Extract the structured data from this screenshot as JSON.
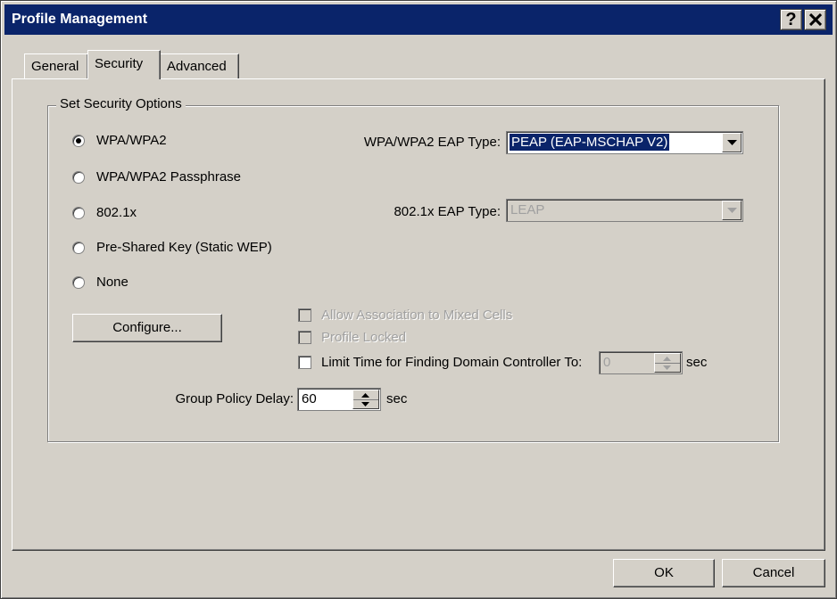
{
  "window": {
    "title": "Profile Management",
    "help_glyph": "?",
    "close_icon": "close-icon"
  },
  "tabs": [
    {
      "label": "General",
      "selected": false
    },
    {
      "label": "Security",
      "selected": true
    },
    {
      "label": "Advanced",
      "selected": false
    }
  ],
  "security": {
    "group_label": "Set Security Options",
    "options": [
      {
        "label": "WPA/WPA2",
        "selected": true
      },
      {
        "label": "WPA/WPA2 Passphrase",
        "selected": false
      },
      {
        "label": "802.1x",
        "selected": false
      },
      {
        "label": "Pre-Shared Key (Static WEP)",
        "selected": false
      },
      {
        "label": "None",
        "selected": false
      }
    ],
    "wpa_eap_label": "WPA/WPA2 EAP Type:",
    "wpa_eap_value": "PEAP (EAP-MSCHAP V2)",
    "dot1x_eap_label": "802.1x EAP Type:",
    "dot1x_eap_value": "LEAP",
    "configure_label": "Configure...",
    "allow_mixed_label": "Allow Association to Mixed Cells",
    "allow_mixed_checked": false,
    "profile_locked_label": "Profile Locked",
    "profile_locked_checked": false,
    "limit_time_label": "Limit Time for Finding Domain Controller To:",
    "limit_time_checked": false,
    "limit_time_value": "0",
    "limit_time_unit": "sec",
    "group_policy_label": "Group Policy Delay:",
    "group_policy_value": "60",
    "group_policy_unit": "sec"
  },
  "buttons": {
    "ok": "OK",
    "cancel": "Cancel"
  },
  "colors": {
    "face": "#d4d0c8",
    "titlebar": "#0a246a",
    "selection": "#0a246a",
    "disabled_text": "#a0a0a0"
  }
}
